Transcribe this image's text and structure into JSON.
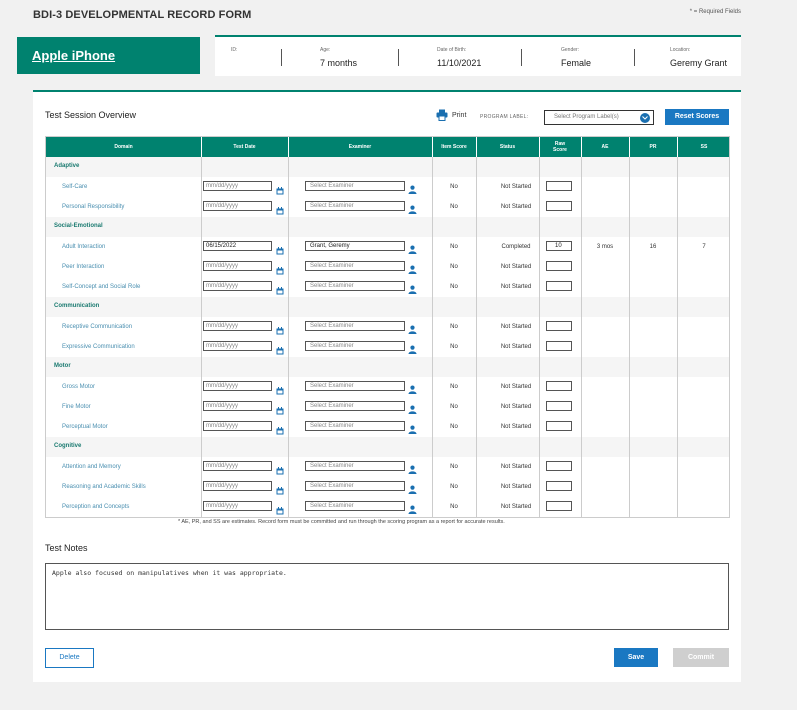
{
  "header": {
    "title": "BDI-3 DEVELOPMENTAL RECORD FORM",
    "required_note": "* = Required Fields"
  },
  "child": {
    "name": "Apple iPhone",
    "id_label": "ID:",
    "id_value": "",
    "age_label": "Age:",
    "age_value": "7 months",
    "dob_label": "Date of Birth:",
    "dob_value": "11/10/2021",
    "gender_label": "Gender:",
    "gender_value": "Female",
    "location_label": "Location:",
    "location_value": "Geremy Grant"
  },
  "overview": {
    "title": "Test Session Overview",
    "print_label": "Print",
    "program_label": "PROGRAM LABEL:",
    "program_placeholder": "Select Program Label(s)",
    "reset_label": "Reset Scores"
  },
  "columns": {
    "domain": "Domain",
    "test_date": "Test Date",
    "examiner": "Examiner",
    "item_score": "Item Score",
    "status": "Status",
    "raw_score": "Raw Score",
    "ae": "AE",
    "pr": "PR",
    "ss": "SS"
  },
  "placeholders": {
    "date": "mm/dd/yyyy",
    "examiner": "Select Examiner"
  },
  "groups": [
    {
      "label": "Adaptive",
      "rows": [
        {
          "domain": "Self-Care",
          "date": "",
          "examiner": "",
          "item": "No",
          "status": "Not Started",
          "raw": "",
          "ae": "",
          "pr": "",
          "ss": ""
        },
        {
          "domain": "Personal Responsibility",
          "date": "",
          "examiner": "",
          "item": "No",
          "status": "Not Started",
          "raw": "",
          "ae": "",
          "pr": "",
          "ss": ""
        }
      ]
    },
    {
      "label": "Social-Emotional",
      "rows": [
        {
          "domain": "Adult Interaction",
          "date": "06/15/2022",
          "examiner": "Grant, Geremy",
          "item": "No",
          "status": "Completed",
          "raw": "10",
          "ae": "3 mos",
          "pr": "16",
          "ss": "7"
        },
        {
          "domain": "Peer Interaction",
          "date": "",
          "examiner": "",
          "item": "No",
          "status": "Not Started",
          "raw": "",
          "ae": "",
          "pr": "",
          "ss": ""
        },
        {
          "domain": "Self-Concept and Social Role",
          "date": "",
          "examiner": "",
          "item": "No",
          "status": "Not Started",
          "raw": "",
          "ae": "",
          "pr": "",
          "ss": ""
        }
      ]
    },
    {
      "label": "Communication",
      "rows": [
        {
          "domain": "Receptive Communication",
          "date": "",
          "examiner": "",
          "item": "No",
          "status": "Not Started",
          "raw": "",
          "ae": "",
          "pr": "",
          "ss": ""
        },
        {
          "domain": "Expressive Communication",
          "date": "",
          "examiner": "",
          "item": "No",
          "status": "Not Started",
          "raw": "",
          "ae": "",
          "pr": "",
          "ss": ""
        }
      ]
    },
    {
      "label": "Motor",
      "rows": [
        {
          "domain": "Gross Motor",
          "date": "",
          "examiner": "",
          "item": "No",
          "status": "Not Started",
          "raw": "",
          "ae": "",
          "pr": "",
          "ss": ""
        },
        {
          "domain": "Fine Motor",
          "date": "",
          "examiner": "",
          "item": "No",
          "status": "Not Started",
          "raw": "",
          "ae": "",
          "pr": "",
          "ss": ""
        },
        {
          "domain": "Perceptual Motor",
          "date": "",
          "examiner": "",
          "item": "No",
          "status": "Not Started",
          "raw": "",
          "ae": "",
          "pr": "",
          "ss": ""
        }
      ]
    },
    {
      "label": "Cognitive",
      "rows": [
        {
          "domain": "Attention and Memory",
          "date": "",
          "examiner": "",
          "item": "No",
          "status": "Not Started",
          "raw": "",
          "ae": "",
          "pr": "",
          "ss": ""
        },
        {
          "domain": "Reasoning and Academic Skills",
          "date": "",
          "examiner": "",
          "item": "No",
          "status": "Not Started",
          "raw": "",
          "ae": "",
          "pr": "",
          "ss": ""
        },
        {
          "domain": "Perception and Concepts",
          "date": "",
          "examiner": "",
          "item": "No",
          "status": "Not Started",
          "raw": "",
          "ae": "",
          "pr": "",
          "ss": ""
        }
      ]
    }
  ],
  "footnote": "* AE, PR, and SS are estimates. Record form must be committed and run through the scoring program as a report for accurate results.",
  "notes": {
    "title": "Test Notes",
    "text": "Apple also focused on manipulatives when it was appropriate."
  },
  "actions": {
    "delete": "Delete",
    "save": "Save",
    "commit": "Commit"
  },
  "colors": {
    "brand_green": "#00826f",
    "action_blue": "#1a78c2",
    "disabled_gray": "#cfcfcf"
  },
  "icons": [
    "print-icon",
    "chevron-down-icon",
    "calendar-icon",
    "person-icon"
  ]
}
